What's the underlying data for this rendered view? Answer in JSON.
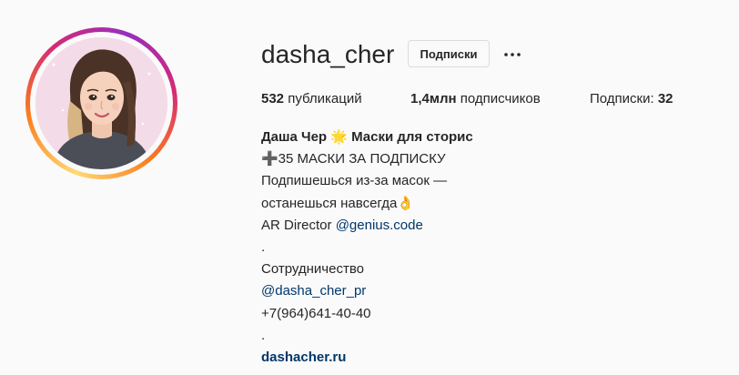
{
  "profile": {
    "username": "dasha_cher",
    "follow_button_label": "Подписки",
    "more_icon": "more-horizontal-icon"
  },
  "stats": {
    "posts_count": "532",
    "posts_label": "публикаций",
    "followers_count": "1,4млн",
    "followers_label": "подписчиков",
    "following_label": "Подписки:",
    "following_count": "32"
  },
  "bio": {
    "full_name": "Даша Чер 🌟 Маски для сторис",
    "line1": "➕35 МАСКИ ЗА ПОДПИСКУ",
    "line2": "Подпишешься из-за масок —",
    "line3": "останешься навсегда👌",
    "line4_prefix": "AR Director",
    "line4_mention": "@genius.code",
    "dot1": ".",
    "line5": "Сотрудничество",
    "line6_mention": "@dasha_cher_pr",
    "line7": "+7(964)641-40-40",
    "dot2": ".",
    "website": "dashacher.ru"
  },
  "colors": {
    "text": "#262626",
    "link": "#00376b",
    "ring_gradient": [
      "#feda75",
      "#fa7e1e",
      "#d62976",
      "#962fbf"
    ]
  }
}
